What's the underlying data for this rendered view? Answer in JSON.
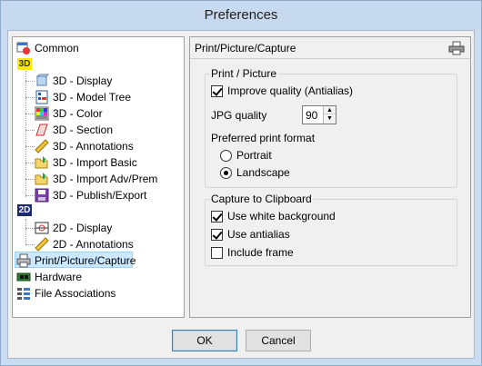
{
  "window": {
    "title": "Preferences"
  },
  "tree": {
    "common": "Common",
    "tag3d": "3D",
    "tag2d": "2D",
    "items3d": [
      "3D - Display",
      "3D - Model Tree",
      "3D - Color",
      "3D - Section",
      "3D - Annotations",
      "3D - Import Basic",
      "3D - Import Adv/Prem",
      "3D - Publish/Export"
    ],
    "items2d": [
      "2D - Display",
      "2D - Annotations"
    ],
    "print": "Print/Picture/Capture",
    "hardware": "Hardware",
    "file_assoc": "File Associations"
  },
  "panel": {
    "header": "Print/Picture/Capture",
    "print_group": {
      "title": "Print / Picture",
      "improve_quality": "Improve quality (Antialias)",
      "improve_quality_checked": true,
      "jpg_quality_label": "JPG quality",
      "jpg_quality_value": "90",
      "format_label": "Preferred print format",
      "portrait": "Portrait",
      "landscape": "Landscape",
      "selected_format": "Landscape"
    },
    "capture_group": {
      "title": "Capture to Clipboard",
      "white_bg": "Use white background",
      "white_bg_checked": true,
      "antialias": "Use antialias",
      "antialias_checked": true,
      "include_frame": "Include frame",
      "include_frame_checked": false
    }
  },
  "buttons": {
    "ok": "OK",
    "cancel": "Cancel"
  }
}
